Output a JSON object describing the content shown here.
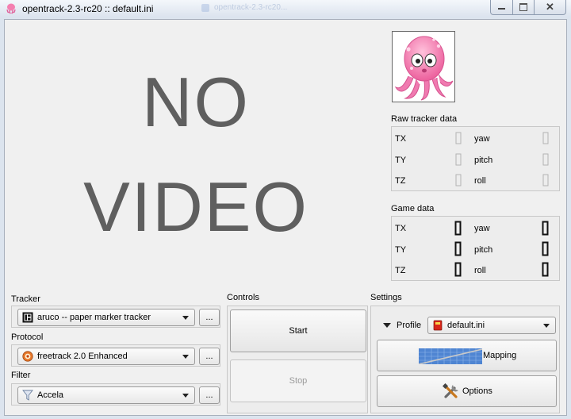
{
  "window": {
    "title": "opentrack-2.3-rc20 :: default.ini",
    "ghost_title": "opentrack-2.3-rc20..."
  },
  "video": {
    "line1": "NO",
    "line2": "VIDEO"
  },
  "raw_tracker": {
    "title": "Raw tracker data",
    "labels": {
      "tx": "TX",
      "ty": "TY",
      "tz": "TZ",
      "yaw": "yaw",
      "pitch": "pitch",
      "roll": "roll"
    }
  },
  "game_data": {
    "title": "Game data",
    "labels": {
      "tx": "TX",
      "ty": "TY",
      "tz": "TZ",
      "yaw": "yaw",
      "pitch": "pitch",
      "roll": "roll"
    }
  },
  "tracker": {
    "label": "Tracker",
    "value": "aruco -- paper marker tracker",
    "more": "..."
  },
  "protocol": {
    "label": "Protocol",
    "value": "freetrack 2.0 Enhanced",
    "more": "..."
  },
  "filter": {
    "label": "Filter",
    "value": "Accela",
    "more": "..."
  },
  "controls": {
    "label": "Controls",
    "start": "Start",
    "stop": "Stop"
  },
  "settings": {
    "label": "Settings",
    "profile": "Profile",
    "profile_value": "default.ini",
    "mapping": "Mapping",
    "options": "Options"
  },
  "colors": {
    "accent": "#3c6ed0",
    "octopus": "#f47fb0"
  }
}
